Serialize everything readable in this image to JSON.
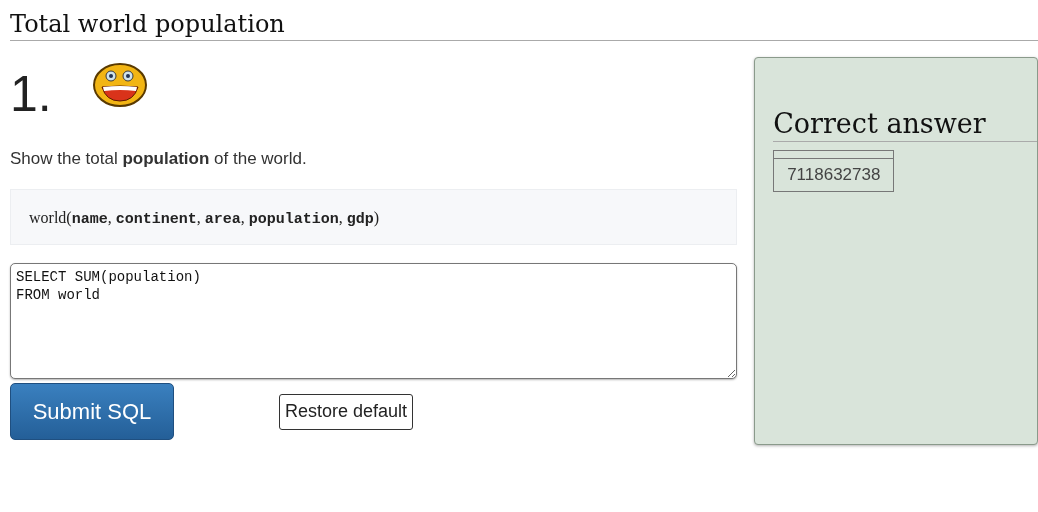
{
  "page": {
    "title": "Total world population"
  },
  "question": {
    "number": "1.",
    "text": "Show the total **population** of the world.",
    "schema": "world(**name**, **continent**, **area**, **population**, **gdp**)"
  },
  "editor": {
    "value": "SELECT SUM(population)\nFROM world"
  },
  "buttons": [
    {
      "kind": "primary",
      "label": "Submit SQL"
    },
    {
      "kind": "secondary",
      "label": "Restore default"
    }
  ],
  "answer": {
    "title": "Correct answer",
    "rows": [
      [
        "7118632738"
      ]
    ]
  }
}
